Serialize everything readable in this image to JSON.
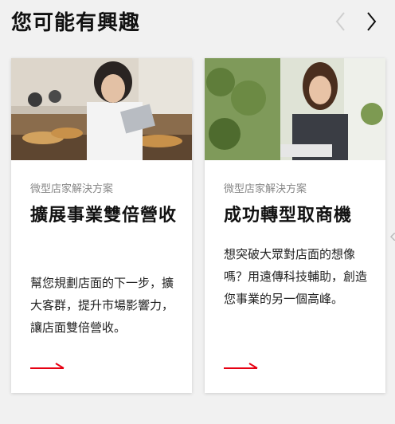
{
  "header": {
    "title": "您可能有興趣"
  },
  "nav": {
    "prev_icon": "chevron-left-icon",
    "next_icon": "chevron-right-icon"
  },
  "cards": [
    {
      "category": "微型店家解決方案",
      "title": "擴展事業雙倍營收",
      "description": "幫您規劃店面的下一步，擴大客群，提升市場影響力，讓店面雙倍營收。",
      "image": "baker-with-tablet-photo",
      "arrow_icon": "arrow-right-icon"
    },
    {
      "category": "微型店家解決方案",
      "title": "成功轉型取商機",
      "description": "想突破大眾對店面的想像嗎？用遠傳科技輔助，創造您事業的另一個高峰。",
      "image": "florist-with-tablet-photo",
      "arrow_icon": "arrow-right-icon"
    }
  ],
  "colors": {
    "accent": "#e60012",
    "background": "#f1f1f1",
    "card": "#ffffff",
    "category_text": "#888888"
  }
}
